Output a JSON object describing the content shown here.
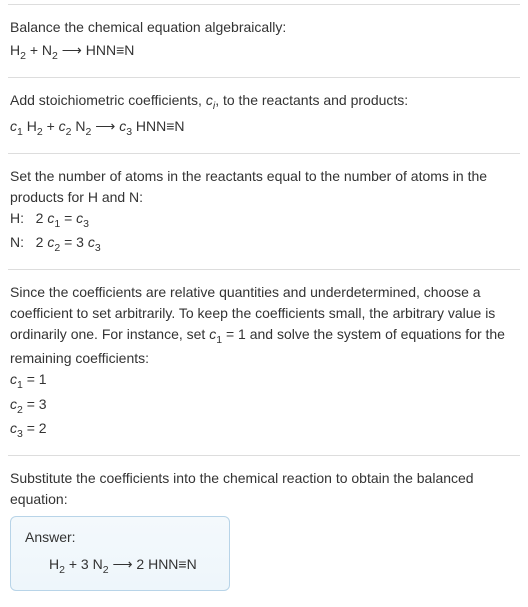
{
  "sections": {
    "balance": {
      "intro": "Balance the chemical equation algebraically:",
      "eq_html": "H<sub>2</sub> + N<sub>2</sub>  ⟶  HNN≡N"
    },
    "stoich": {
      "intro": "Add stoichiometric coefficients, c_i, to the reactants and products:",
      "intro_html": "Add stoichiometric coefficients, <i>c<sub>i</sub></i>, to the reactants and products:",
      "eq_html": "<i>c</i><sub>1</sub> H<sub>2</sub> + <i>c</i><sub>2</sub> N<sub>2</sub>  ⟶  <i>c</i><sub>3</sub> HNN≡N"
    },
    "atoms": {
      "intro": "Set the number of atoms in the reactants equal to the number of atoms in the products for H and N:",
      "rows_html": [
        "H:&nbsp;&nbsp;&nbsp;2 <i>c</i><sub>1</sub> = <i>c</i><sub>3</sub>",
        "N:&nbsp;&nbsp;&nbsp;2 <i>c</i><sub>2</sub> = 3 <i>c</i><sub>3</sub>"
      ]
    },
    "solve": {
      "intro_html": "Since the coefficients are relative quantities and underdetermined, choose a coefficient to set arbitrarily. To keep the coefficients small, the arbitrary value is ordinarily one. For instance, set <i>c</i><sub>1</sub> = 1 and solve the system of equations for the remaining coefficients:",
      "rows_html": [
        "<i>c</i><sub>1</sub> = 1",
        "<i>c</i><sub>2</sub> = 3",
        "<i>c</i><sub>3</sub> = 2"
      ]
    },
    "sub": {
      "intro": "Substitute the coefficients into the chemical reaction to obtain the balanced equation:"
    },
    "answer": {
      "label": "Answer:",
      "eq_html": "H<sub>2</sub> + 3 N<sub>2</sub>  ⟶  2 HNN≡N"
    }
  }
}
